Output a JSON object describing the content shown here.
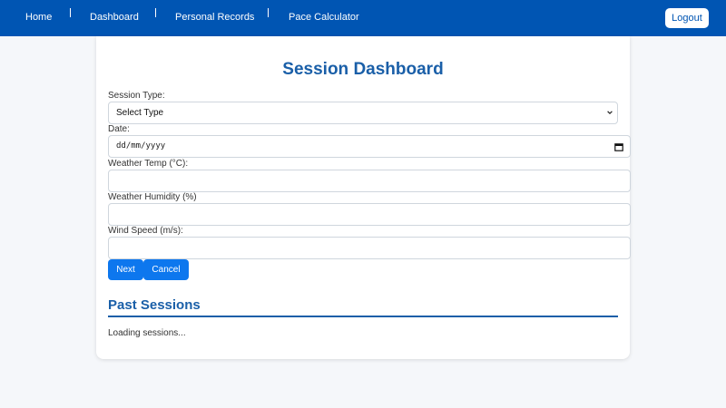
{
  "nav": {
    "links": [
      "Home",
      "Dashboard",
      "Personal Records",
      "Pace Calculator"
    ],
    "logout_label": "Logout"
  },
  "page": {
    "title": "Session Dashboard"
  },
  "form": {
    "session_type": {
      "label": "Session Type:",
      "value": "Select Type"
    },
    "date": {
      "label": "Date:",
      "placeholder": "dd/mm/yyyy"
    },
    "weather_temp": {
      "label": "Weather Temp (°C):",
      "value": ""
    },
    "weather_humidity": {
      "label": "Weather Humidity (%)",
      "value": ""
    },
    "wind_speed": {
      "label": "Wind Speed (m/s):",
      "value": ""
    },
    "next_label": "Next",
    "cancel_label": "Cancel"
  },
  "past_sessions": {
    "title": "Past Sessions",
    "status": "Loading sessions..."
  },
  "colors": {
    "nav_bg": "#0055b3",
    "accent": "#1a5fa8",
    "button": "#0d77ee",
    "page_bg": "#f5f7fa"
  },
  "icons": [
    "chevron-down-icon",
    "calendar-icon"
  ]
}
